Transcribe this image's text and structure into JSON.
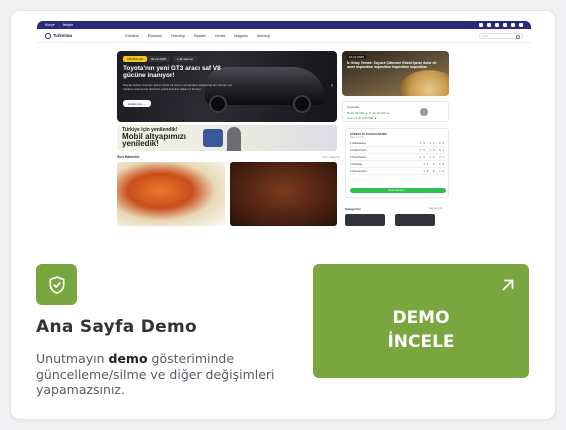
{
  "colors": {
    "accent": "#7aa640",
    "site_topbar": "#2b2a7a",
    "background": "#f1f1f3"
  },
  "preview": {
    "topbar": {
      "left_items": [
        "Künye",
        "İletişim"
      ],
      "social_icons": [
        "x-icon",
        "facebook-icon",
        "instagram-icon",
        "whatsapp-icon",
        "linkedin-icon",
        "youtube-icon"
      ]
    },
    "logo": "Turkmiwa",
    "menu": [
      "Gündem",
      "Ekonomi",
      "Teknoloji",
      "Siyaset",
      "Yemek",
      "Magazin",
      "Astroloji"
    ],
    "search_placeholder": "Ara...",
    "hero": {
      "tag1": "ARABALAR",
      "tag2": "02.12.2025",
      "tag3": "1 dk okuma",
      "title": "Toyota'nın yeni GT3 aracı saf V8 gücüne inanıyor!",
      "subtitle": "Sayılar kuban 2 korum ipsum dolor sit amet, consectetur adipiscing elit. Donec vel tristique quis purus tincidunt porta Aracılar hakem 2 Korem",
      "button": "Haberi oku →"
    },
    "side1": {
      "date": "10.11.2025",
      "title": "İz Gelay Yemek: Soyucé Çökermé Gözde İpnsé dolor sit amet imposition imposition imposition imposition"
    },
    "side2": {
      "label": "Piyasalar",
      "value1": "Dolar 42,000 ▲   % 42,46.000 ▲",
      "value2": "Gram 5.4K 546.000 ▲"
    },
    "banner": {
      "line1": "Türkiye için yenilendik!",
      "line2": "Mobil altyapımızı yeniledik!"
    },
    "news_heading": "Son Haberler",
    "news_more": "Tüm Haberler",
    "table": {
      "title": "SÜPER LİG PUAN DURUMU",
      "subtitle": "Takım   O   G   P",
      "rows": [
        {
          "team": "1  Galatasaray",
          "vals": "15 11 36"
        },
        {
          "team": "2  Trabzonspor",
          "vals": "15 10 34"
        },
        {
          "team": "3  Fenerbahçe",
          "vals": "15 10 33"
        },
        {
          "team": "4  Göztepe",
          "vals": "15 9 28"
        },
        {
          "team": "5  Samsunspor",
          "vals": "15 8 26"
        }
      ],
      "button": "Puan durumu →"
    },
    "categories": {
      "title": "Kategoriler",
      "more": "Hepsini gör"
    }
  },
  "title": "Ana Sayfa Demo",
  "description": {
    "before": "Unutmayın ",
    "bold": "demo",
    "after": " gösteriminde güncelleme/silme ve diğer değişimleri yapamazsınız."
  },
  "demo_button": {
    "line1": "DEMO",
    "line2": "İNCELE"
  },
  "icons": {
    "shield": "shield-check-icon",
    "arrow": "arrow-up-right-icon"
  }
}
